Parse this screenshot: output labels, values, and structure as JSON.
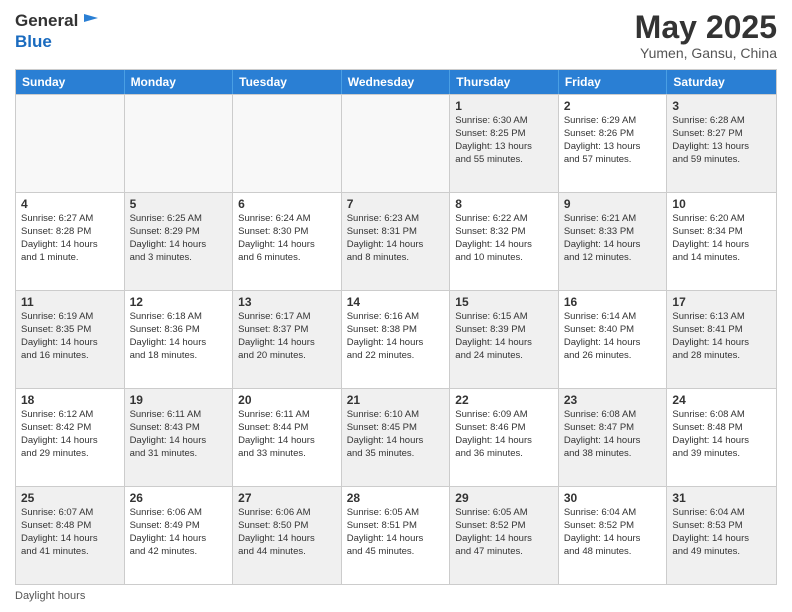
{
  "header": {
    "logo_line1": "General",
    "logo_line2": "Blue",
    "title": "May 2025",
    "subtitle": "Yumen, Gansu, China"
  },
  "days_of_week": [
    "Sunday",
    "Monday",
    "Tuesday",
    "Wednesday",
    "Thursday",
    "Friday",
    "Saturday"
  ],
  "footer_text": "Daylight hours",
  "weeks": [
    [
      {
        "day": "",
        "text": "",
        "empty": true
      },
      {
        "day": "",
        "text": "",
        "empty": true
      },
      {
        "day": "",
        "text": "",
        "empty": true
      },
      {
        "day": "",
        "text": "",
        "empty": true
      },
      {
        "day": "1",
        "text": "Sunrise: 6:30 AM\nSunset: 8:25 PM\nDaylight: 13 hours\nand 55 minutes.",
        "empty": false
      },
      {
        "day": "2",
        "text": "Sunrise: 6:29 AM\nSunset: 8:26 PM\nDaylight: 13 hours\nand 57 minutes.",
        "empty": false
      },
      {
        "day": "3",
        "text": "Sunrise: 6:28 AM\nSunset: 8:27 PM\nDaylight: 13 hours\nand 59 minutes.",
        "empty": false
      }
    ],
    [
      {
        "day": "4",
        "text": "Sunrise: 6:27 AM\nSunset: 8:28 PM\nDaylight: 14 hours\nand 1 minute.",
        "empty": false
      },
      {
        "day": "5",
        "text": "Sunrise: 6:25 AM\nSunset: 8:29 PM\nDaylight: 14 hours\nand 3 minutes.",
        "empty": false
      },
      {
        "day": "6",
        "text": "Sunrise: 6:24 AM\nSunset: 8:30 PM\nDaylight: 14 hours\nand 6 minutes.",
        "empty": false
      },
      {
        "day": "7",
        "text": "Sunrise: 6:23 AM\nSunset: 8:31 PM\nDaylight: 14 hours\nand 8 minutes.",
        "empty": false
      },
      {
        "day": "8",
        "text": "Sunrise: 6:22 AM\nSunset: 8:32 PM\nDaylight: 14 hours\nand 10 minutes.",
        "empty": false
      },
      {
        "day": "9",
        "text": "Sunrise: 6:21 AM\nSunset: 8:33 PM\nDaylight: 14 hours\nand 12 minutes.",
        "empty": false
      },
      {
        "day": "10",
        "text": "Sunrise: 6:20 AM\nSunset: 8:34 PM\nDaylight: 14 hours\nand 14 minutes.",
        "empty": false
      }
    ],
    [
      {
        "day": "11",
        "text": "Sunrise: 6:19 AM\nSunset: 8:35 PM\nDaylight: 14 hours\nand 16 minutes.",
        "empty": false
      },
      {
        "day": "12",
        "text": "Sunrise: 6:18 AM\nSunset: 8:36 PM\nDaylight: 14 hours\nand 18 minutes.",
        "empty": false
      },
      {
        "day": "13",
        "text": "Sunrise: 6:17 AM\nSunset: 8:37 PM\nDaylight: 14 hours\nand 20 minutes.",
        "empty": false
      },
      {
        "day": "14",
        "text": "Sunrise: 6:16 AM\nSunset: 8:38 PM\nDaylight: 14 hours\nand 22 minutes.",
        "empty": false
      },
      {
        "day": "15",
        "text": "Sunrise: 6:15 AM\nSunset: 8:39 PM\nDaylight: 14 hours\nand 24 minutes.",
        "empty": false
      },
      {
        "day": "16",
        "text": "Sunrise: 6:14 AM\nSunset: 8:40 PM\nDaylight: 14 hours\nand 26 minutes.",
        "empty": false
      },
      {
        "day": "17",
        "text": "Sunrise: 6:13 AM\nSunset: 8:41 PM\nDaylight: 14 hours\nand 28 minutes.",
        "empty": false
      }
    ],
    [
      {
        "day": "18",
        "text": "Sunrise: 6:12 AM\nSunset: 8:42 PM\nDaylight: 14 hours\nand 29 minutes.",
        "empty": false
      },
      {
        "day": "19",
        "text": "Sunrise: 6:11 AM\nSunset: 8:43 PM\nDaylight: 14 hours\nand 31 minutes.",
        "empty": false
      },
      {
        "day": "20",
        "text": "Sunrise: 6:11 AM\nSunset: 8:44 PM\nDaylight: 14 hours\nand 33 minutes.",
        "empty": false
      },
      {
        "day": "21",
        "text": "Sunrise: 6:10 AM\nSunset: 8:45 PM\nDaylight: 14 hours\nand 35 minutes.",
        "empty": false
      },
      {
        "day": "22",
        "text": "Sunrise: 6:09 AM\nSunset: 8:46 PM\nDaylight: 14 hours\nand 36 minutes.",
        "empty": false
      },
      {
        "day": "23",
        "text": "Sunrise: 6:08 AM\nSunset: 8:47 PM\nDaylight: 14 hours\nand 38 minutes.",
        "empty": false
      },
      {
        "day": "24",
        "text": "Sunrise: 6:08 AM\nSunset: 8:48 PM\nDaylight: 14 hours\nand 39 minutes.",
        "empty": false
      }
    ],
    [
      {
        "day": "25",
        "text": "Sunrise: 6:07 AM\nSunset: 8:48 PM\nDaylight: 14 hours\nand 41 minutes.",
        "empty": false
      },
      {
        "day": "26",
        "text": "Sunrise: 6:06 AM\nSunset: 8:49 PM\nDaylight: 14 hours\nand 42 minutes.",
        "empty": false
      },
      {
        "day": "27",
        "text": "Sunrise: 6:06 AM\nSunset: 8:50 PM\nDaylight: 14 hours\nand 44 minutes.",
        "empty": false
      },
      {
        "day": "28",
        "text": "Sunrise: 6:05 AM\nSunset: 8:51 PM\nDaylight: 14 hours\nand 45 minutes.",
        "empty": false
      },
      {
        "day": "29",
        "text": "Sunrise: 6:05 AM\nSunset: 8:52 PM\nDaylight: 14 hours\nand 47 minutes.",
        "empty": false
      },
      {
        "day": "30",
        "text": "Sunrise: 6:04 AM\nSunset: 8:52 PM\nDaylight: 14 hours\nand 48 minutes.",
        "empty": false
      },
      {
        "day": "31",
        "text": "Sunrise: 6:04 AM\nSunset: 8:53 PM\nDaylight: 14 hours\nand 49 minutes.",
        "empty": false
      }
    ]
  ]
}
